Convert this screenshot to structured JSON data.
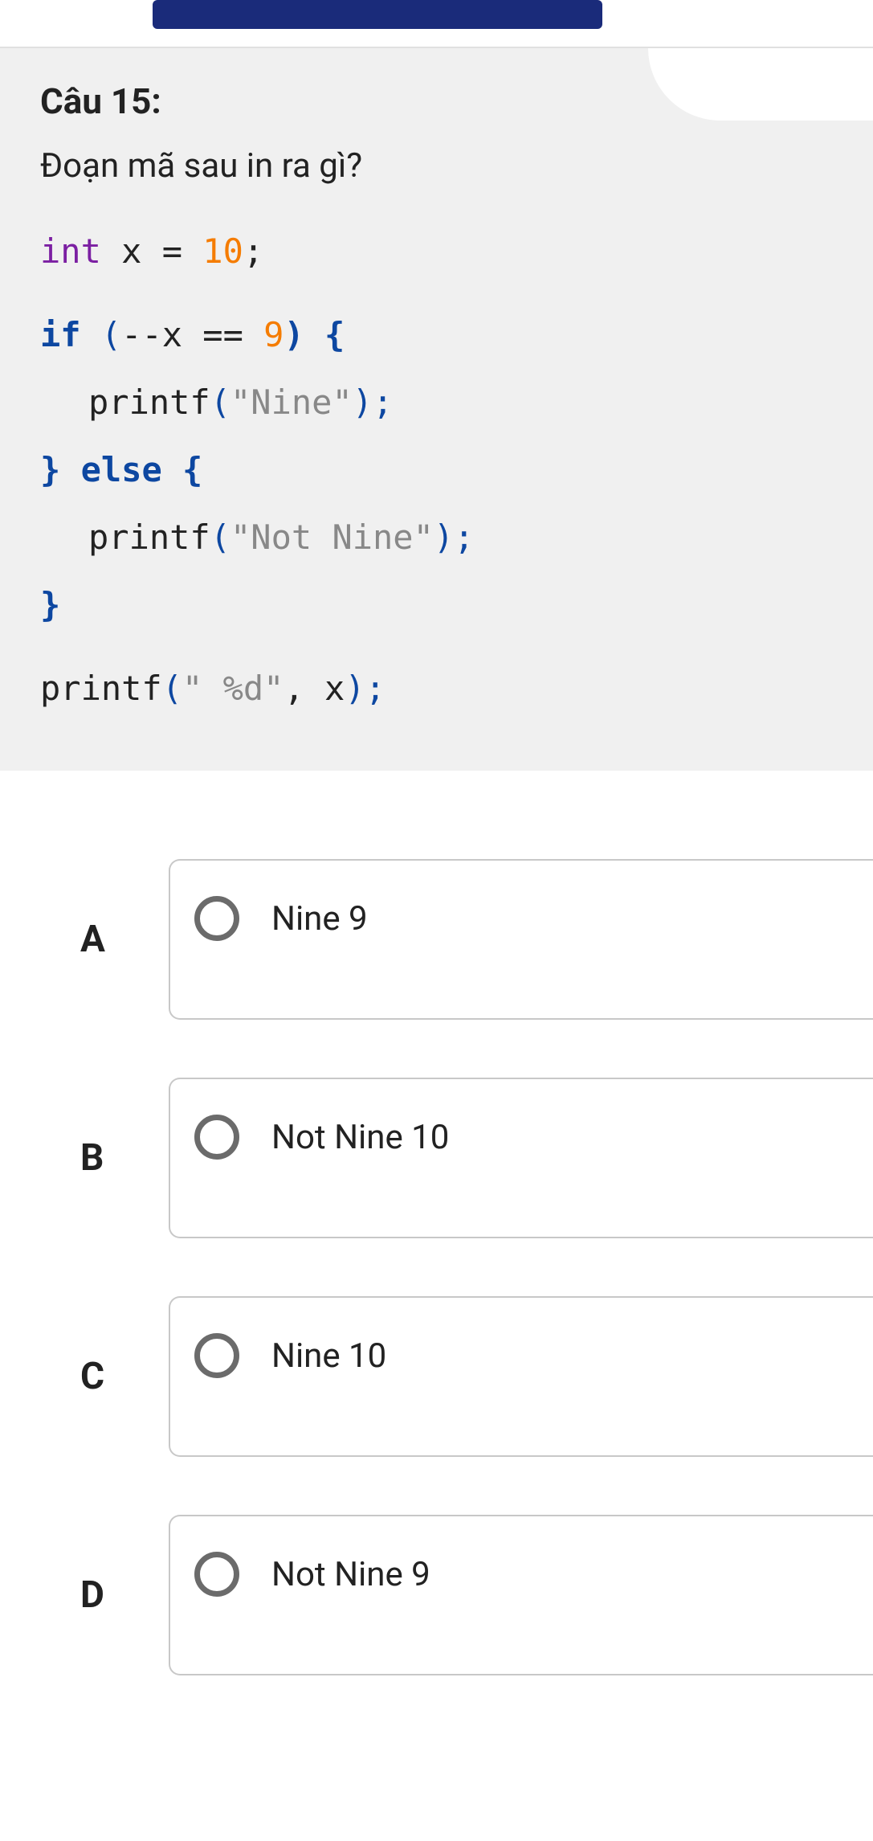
{
  "question": {
    "number": "Câu 15:",
    "prompt": "Đoạn mã sau in ra gì?",
    "code": {
      "l1_kw": "int",
      "l1_rest1": " x = ",
      "l1_num": "10",
      "l1_rest2": ";",
      "l2_kw": "if",
      "l2_p1": " (",
      "l2_mid": "--x == ",
      "l2_num": "9",
      "l2_p2": ") {",
      "l3_fn": "printf",
      "l3_p1": "(",
      "l3_str": "\"Nine\"",
      "l3_p2": ");",
      "l4_b1": "}",
      "l4_kw": " else ",
      "l4_b2": "{",
      "l5_fn": "printf",
      "l5_p1": "(",
      "l5_str": "\"Not Nine\"",
      "l5_p2": ");",
      "l6_b": "}",
      "l7_fn": "printf",
      "l7_p1": "(",
      "l7_str": "\" %d\"",
      "l7_mid": ", x",
      "l7_p2": ");"
    }
  },
  "answers": [
    {
      "letter": "A",
      "text": "Nine 9"
    },
    {
      "letter": "B",
      "text": "Not Nine 10"
    },
    {
      "letter": "C",
      "text": "Nine 10"
    },
    {
      "letter": "D",
      "text": "Not Nine 9"
    }
  ]
}
